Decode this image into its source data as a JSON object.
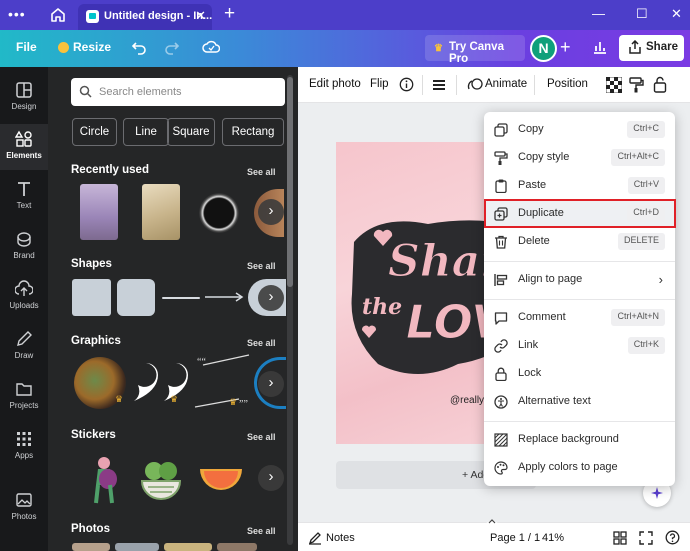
{
  "browser": {
    "tab_title": "Untitled design - In...",
    "menu_dots": "•••"
  },
  "header": {
    "file_label": "File",
    "resize_label": "Resize",
    "try_pro_label": "Try Canva Pro",
    "avatar_initial": "N",
    "share_label": "Share"
  },
  "rail": {
    "items": [
      {
        "label": "Design",
        "icon": "design-icon"
      },
      {
        "label": "Elements",
        "icon": "elements-icon"
      },
      {
        "label": "Text",
        "icon": "text-icon"
      },
      {
        "label": "Brand",
        "icon": "brand-icon"
      },
      {
        "label": "Uploads",
        "icon": "uploads-icon"
      },
      {
        "label": "Draw",
        "icon": "draw-icon"
      },
      {
        "label": "Projects",
        "icon": "projects-icon"
      },
      {
        "label": "Apps",
        "icon": "apps-icon"
      },
      {
        "label": "Photos",
        "icon": "photos-icon"
      }
    ]
  },
  "panel": {
    "search_placeholder": "Search elements",
    "chips": [
      "Circle",
      "Line",
      "Square",
      "Rectang"
    ],
    "see_all": "See all",
    "sections": {
      "recently_used": "Recently used",
      "shapes": "Shapes",
      "graphics": "Graphics",
      "stickers": "Stickers",
      "photos": "Photos"
    }
  },
  "toolbar": {
    "edit_photo": "Edit photo",
    "flip": "Flip",
    "animate": "Animate",
    "position": "Position"
  },
  "canvas": {
    "watermark": "@really",
    "add_page": "+ Add"
  },
  "footer": {
    "notes": "Notes",
    "page": "Page 1 / 1",
    "zoom": "41%"
  },
  "context_menu": {
    "items": [
      {
        "label": "Copy",
        "shortcut": "Ctrl+C",
        "icon": "copy-icon"
      },
      {
        "label": "Copy style",
        "shortcut": "Ctrl+Alt+C",
        "icon": "paint-roller-icon"
      },
      {
        "label": "Paste",
        "shortcut": "Ctrl+V",
        "icon": "clipboard-icon"
      },
      {
        "label": "Duplicate",
        "shortcut": "Ctrl+D",
        "icon": "duplicate-icon"
      },
      {
        "label": "Delete",
        "shortcut": "DELETE",
        "icon": "trash-icon"
      },
      {
        "label": "Align to page",
        "shortcut": "",
        "icon": "align-icon"
      },
      {
        "label": "Comment",
        "shortcut": "Ctrl+Alt+N",
        "icon": "comment-icon"
      },
      {
        "label": "Link",
        "shortcut": "Ctrl+K",
        "icon": "link-icon"
      },
      {
        "label": "Lock",
        "shortcut": "",
        "icon": "lock-icon"
      },
      {
        "label": "Alternative text",
        "shortcut": "",
        "icon": "alt-text-icon"
      },
      {
        "label": "Replace background",
        "shortcut": "",
        "icon": "replace-bg-icon"
      },
      {
        "label": "Apply colors to page",
        "shortcut": "",
        "icon": "palette-icon"
      }
    ],
    "highlighted": "Duplicate"
  },
  "colors": {
    "tab_bar": "#4c3ec9",
    "header_start": "#21b9c8",
    "header_end": "#7a3be3",
    "rail_bg": "#18191b",
    "panel_bg": "#252627",
    "highlight_border": "#e02027"
  }
}
